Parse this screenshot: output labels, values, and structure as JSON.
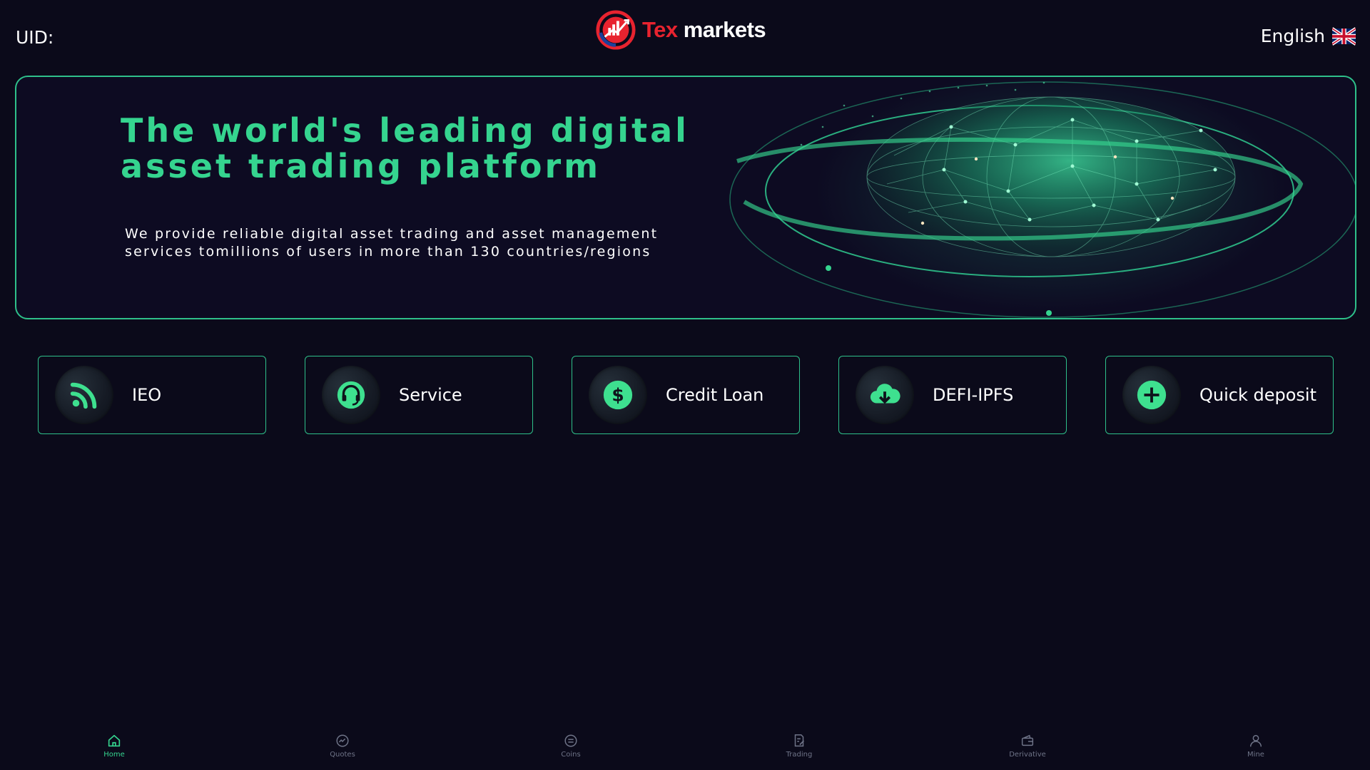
{
  "header": {
    "uid_label": "UID:",
    "logo_text_red": "Tex",
    "logo_text_white": " markets",
    "language": "English"
  },
  "banner": {
    "title": "The world's leading digital asset trading platform",
    "subtitle": "We provide reliable digital asset trading and asset management services tomillions  of users in more than 130 countries/regions"
  },
  "tiles": [
    {
      "label": "IEO",
      "icon": "rss-icon"
    },
    {
      "label": "Service",
      "icon": "headset-icon"
    },
    {
      "label": "Credit Loan",
      "icon": "dollar-icon"
    },
    {
      "label": "DEFI-IPFS",
      "icon": "cloud-download-icon"
    },
    {
      "label": "Quick deposit",
      "icon": "plus-circle-icon"
    }
  ],
  "nav": {
    "active": "Home",
    "items": [
      {
        "label": "Home",
        "icon": "home-icon"
      },
      {
        "label": "Quotes",
        "icon": "chart-circle-icon"
      },
      {
        "label": "Coins",
        "icon": "coin-icon"
      },
      {
        "label": "Trading",
        "icon": "document-edit-icon"
      },
      {
        "label": "Derivative",
        "icon": "wallet-icon"
      },
      {
        "label": "Mine",
        "icon": "user-icon"
      }
    ]
  },
  "colors": {
    "background": "#0b0a1a",
    "accent": "#35d48f",
    "border": "#2ec08a",
    "brand_red": "#e8232f",
    "nav_inactive": "#6f7488"
  }
}
